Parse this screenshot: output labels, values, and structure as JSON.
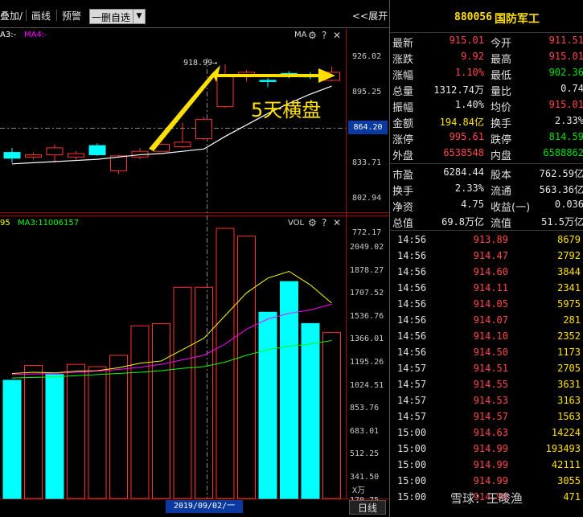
{
  "toolbar": {
    "overlay": "叠加/",
    "draw": "画线",
    "alert": "预警",
    "watchlist": "一删自选",
    "expand": "<<展开"
  },
  "kline": {
    "ma_legend_a": "A3:-",
    "ma_legend_b": "MA4:-",
    "ma_label": "MA",
    "peak_label": "918.99→",
    "current_price_tag": "864.20",
    "y_ticks": [
      "926.02",
      "895.25",
      "833.71",
      "802.94",
      "772.17"
    ],
    "annotation": "5天横盘",
    "candles": [
      {
        "o": 842,
        "c": 837,
        "h": 846,
        "l": 833
      },
      {
        "o": 838,
        "c": 840,
        "h": 842,
        "l": 836
      },
      {
        "o": 840,
        "c": 846,
        "h": 849,
        "l": 833
      },
      {
        "o": 838,
        "c": 841,
        "h": 843,
        "l": 835
      },
      {
        "o": 848,
        "c": 840,
        "h": 850,
        "l": 839
      },
      {
        "o": 826,
        "c": 839,
        "h": 840,
        "l": 823
      },
      {
        "o": 838,
        "c": 843,
        "h": 846,
        "l": 836
      },
      {
        "o": 843,
        "c": 849,
        "h": 850,
        "l": 843
      },
      {
        "o": 847,
        "c": 851,
        "h": 868,
        "l": 846
      },
      {
        "o": 854,
        "c": 871,
        "h": 873,
        "l": 853
      },
      {
        "o": 882,
        "c": 910,
        "h": 919,
        "l": 881
      },
      {
        "o": 910,
        "c": 912,
        "h": 914,
        "l": 904
      },
      {
        "o": 905,
        "c": 904,
        "h": 907,
        "l": 899
      },
      {
        "o": 911,
        "c": 910,
        "h": 913,
        "l": 907
      },
      {
        "o": 910,
        "c": 908,
        "h": 912,
        "l": 906
      },
      {
        "o": 905,
        "c": 912,
        "h": 917,
        "l": 904
      }
    ],
    "ma": [
      832,
      833,
      834,
      835,
      836,
      838,
      840,
      841,
      843,
      845,
      856,
      866,
      876,
      885,
      893,
      900
    ]
  },
  "vol": {
    "legend_a": "95",
    "legend_b": "MA3:11006157",
    "vol_label": "VOL",
    "y_ticks": [
      "2049.02",
      "1878.27",
      "1707.52",
      "1536.76",
      "1366.01",
      "1195.26",
      "1024.51",
      "853.76",
      "683.01",
      "512.25",
      "341.50",
      "170.75"
    ],
    "unit": "X万",
    "bars": [
      {
        "v": 880,
        "up": false
      },
      {
        "v": 1010,
        "up": true
      },
      {
        "v": 930,
        "up": false
      },
      {
        "v": 1020,
        "up": true
      },
      {
        "v": 1000,
        "up": true
      },
      {
        "v": 1100,
        "up": true
      },
      {
        "v": 1360,
        "up": true
      },
      {
        "v": 1380,
        "up": true
      },
      {
        "v": 1700,
        "up": true
      },
      {
        "v": 1700,
        "up": true
      },
      {
        "v": 2300,
        "up": true
      },
      {
        "v": 2150,
        "up": true
      },
      {
        "v": 1480,
        "up": false
      },
      {
        "v": 1750,
        "up": false
      },
      {
        "v": 1380,
        "up": false
      },
      {
        "v": 1300,
        "up": true
      }
    ],
    "ma_yellow": [
      940,
      950,
      945,
      960,
      965,
      990,
      1030,
      1050,
      1150,
      1250,
      1450,
      1650,
      1780,
      1840,
      1720,
      1560
    ],
    "ma_magenta": [
      930,
      935,
      940,
      950,
      960,
      975,
      995,
      1020,
      1060,
      1100,
      1200,
      1330,
      1420,
      1470,
      1500,
      1550
    ],
    "ma_green": [
      900,
      905,
      910,
      920,
      930,
      940,
      950,
      965,
      985,
      1000,
      1040,
      1100,
      1150,
      1180,
      1200,
      1230
    ]
  },
  "date_label": "2019/09/02/一",
  "daily_btn": "日线",
  "panel": {
    "code": "880056",
    "name": "国防军工",
    "quotes": [
      {
        "k": "最新",
        "v": "915.01",
        "vc": "red",
        "k2": "今开",
        "v2": "911.51",
        "v2c": "red"
      },
      {
        "k": "涨跌",
        "v": "9.92",
        "vc": "red",
        "k2": "最高",
        "v2": "915.01",
        "v2c": "red"
      },
      {
        "k": "涨幅",
        "v": "1.10%",
        "vc": "red",
        "k2": "最低",
        "v2": "902.36",
        "v2c": "green"
      },
      {
        "k": "总量",
        "v": "1312.74万",
        "vc": "white",
        "k2": "量比",
        "v2": "0.74",
        "v2c": "white"
      },
      {
        "k": "振幅",
        "v": "1.40%",
        "vc": "white",
        "k2": "均价",
        "v2": "915.01",
        "v2c": "red"
      },
      {
        "k": "金额",
        "v": "194.84亿",
        "vc": "yellow",
        "k2": "换手",
        "v2": "2.33%",
        "v2c": "white"
      },
      {
        "k": "涨停",
        "v": "995.61",
        "vc": "red",
        "k2": "跌停",
        "v2": "814.59",
        "v2c": "green"
      },
      {
        "k": "外盘",
        "v": "6538548",
        "vc": "red",
        "k2": "内盘",
        "v2": "6588862",
        "v2c": "green"
      }
    ],
    "quotes2": [
      {
        "k": "市盈",
        "v": "6284.44",
        "vc": "white",
        "k2": "股本",
        "v2": "762.59亿",
        "v2c": "white"
      },
      {
        "k": "换手",
        "v": "2.33%",
        "vc": "white",
        "k2": "流通",
        "v2": "563.36亿",
        "v2c": "white"
      },
      {
        "k": "净资",
        "v": "4.75",
        "vc": "white",
        "k2": "收益(一)",
        "v2": "0.036",
        "v2c": "white"
      },
      {
        "k": "总值",
        "v": "69.8万亿",
        "vc": "white",
        "k2": "流值",
        "v2": "51.5万亿",
        "v2c": "white"
      }
    ],
    "ticks": [
      {
        "t": "14:56",
        "p": "913.89",
        "v": "8679"
      },
      {
        "t": "14:56",
        "p": "914.47",
        "v": "2792"
      },
      {
        "t": "14:56",
        "p": "914.60",
        "v": "3844"
      },
      {
        "t": "14:56",
        "p": "914.11",
        "v": "2341"
      },
      {
        "t": "14:56",
        "p": "914.05",
        "v": "5975"
      },
      {
        "t": "14:56",
        "p": "914.07",
        "v": "281"
      },
      {
        "t": "14:56",
        "p": "914.10",
        "v": "2352"
      },
      {
        "t": "14:56",
        "p": "914.50",
        "v": "1173"
      },
      {
        "t": "14:57",
        "p": "914.51",
        "v": "2705"
      },
      {
        "t": "14:57",
        "p": "914.55",
        "v": "3631"
      },
      {
        "t": "14:57",
        "p": "914.53",
        "v": "3163"
      },
      {
        "t": "14:57",
        "p": "914.57",
        "v": "1563"
      },
      {
        "t": "15:00",
        "p": "914.63",
        "v": "14224"
      },
      {
        "t": "15:00",
        "p": "914.99",
        "v": "193493"
      },
      {
        "t": "15:00",
        "p": "914.99",
        "v": "42111"
      },
      {
        "t": "15:00",
        "p": "914.99",
        "v": "3055"
      },
      {
        "t": "15:00",
        "p": "914.99",
        "v": "471"
      }
    ]
  },
  "watermark": "雪球：王晙渔",
  "colors": {
    "up": "#ff3030",
    "down": "#00ffff",
    "ma_white": "#ffffff",
    "ma_yellow": "#ffff00",
    "ma_magenta": "#ff00ff",
    "ma_green": "#00ff00",
    "accent": "#ffe000"
  }
}
